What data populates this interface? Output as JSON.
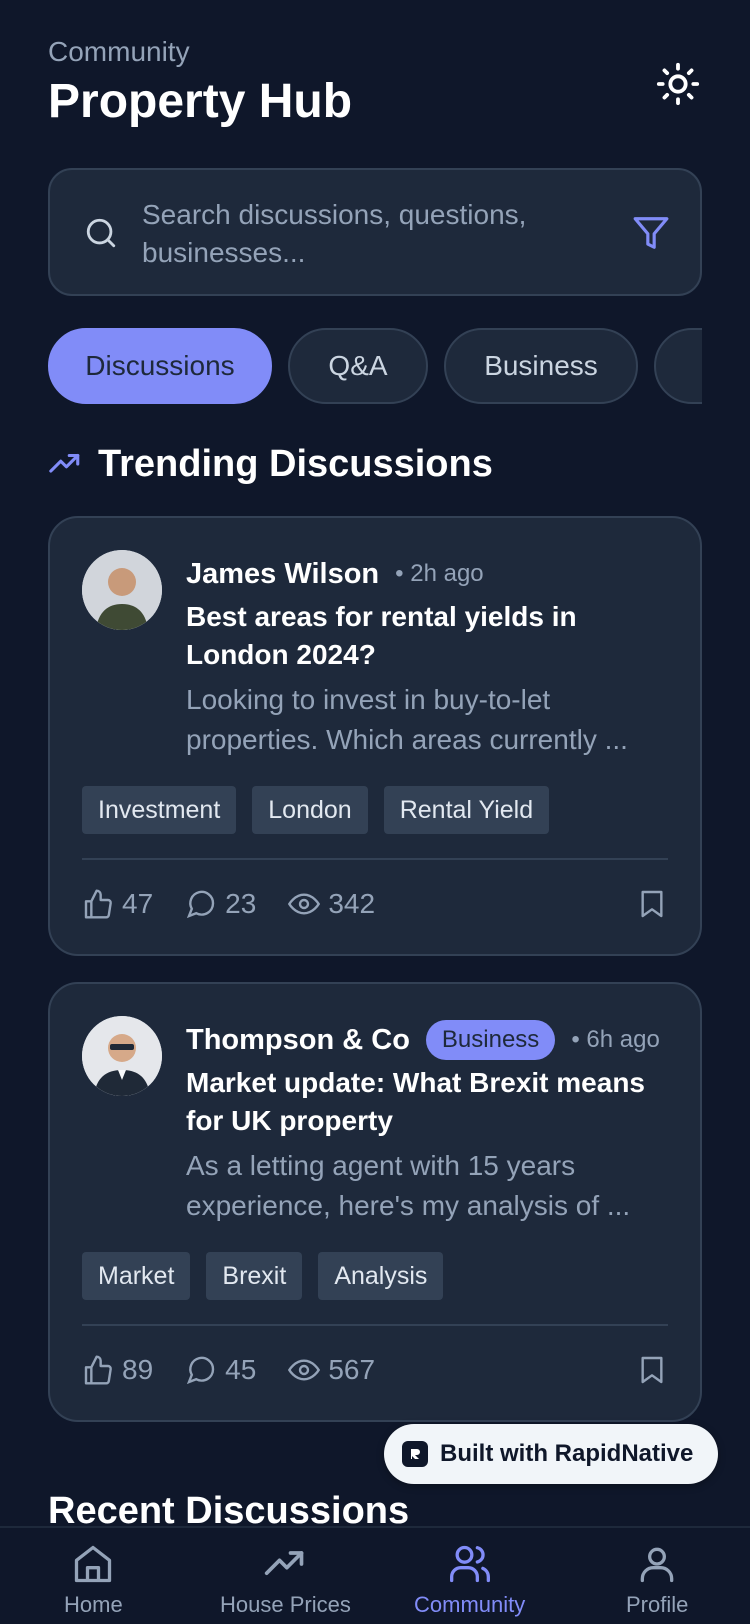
{
  "header": {
    "eyebrow": "Community",
    "title": "Property Hub"
  },
  "search": {
    "placeholder": "Search discussions, questions, businesses..."
  },
  "tabs": [
    {
      "label": "Discussions",
      "active": true
    },
    {
      "label": "Q&A",
      "active": false
    },
    {
      "label": "Business",
      "active": false
    }
  ],
  "trending": {
    "title": "Trending Discussions"
  },
  "posts": [
    {
      "author": "James Wilson",
      "time": "• 2h ago",
      "badge": "",
      "title": "Best areas for rental yields in London 2024?",
      "excerpt": "Looking to invest in buy-to-let properties. Which areas currently ...",
      "tags": [
        "Investment",
        "London",
        "Rental Yield"
      ],
      "likes": "47",
      "comments": "23",
      "views": "342"
    },
    {
      "author": "Thompson & Co",
      "time": "• 6h ago",
      "badge": "Business",
      "title": "Market update: What Brexit means for UK property",
      "excerpt": "As a letting agent with 15 years experience, here's my analysis of ...",
      "tags": [
        "Market",
        "Brexit",
        "Analysis"
      ],
      "likes": "89",
      "comments": "45",
      "views": "567"
    }
  ],
  "recent": {
    "title": "Recent Discussions"
  },
  "built_with": "Built with RapidNative",
  "nav": [
    {
      "label": "Home",
      "icon": "home-icon",
      "active": false
    },
    {
      "label": "House Prices",
      "icon": "trending-icon",
      "active": false
    },
    {
      "label": "Community",
      "icon": "users-icon",
      "active": true
    },
    {
      "label": "Profile",
      "icon": "user-icon",
      "active": false
    }
  ],
  "colors": {
    "background": "#0f172a",
    "card": "#1e293b",
    "accent": "#818cf8",
    "muted": "#94a3b8"
  }
}
